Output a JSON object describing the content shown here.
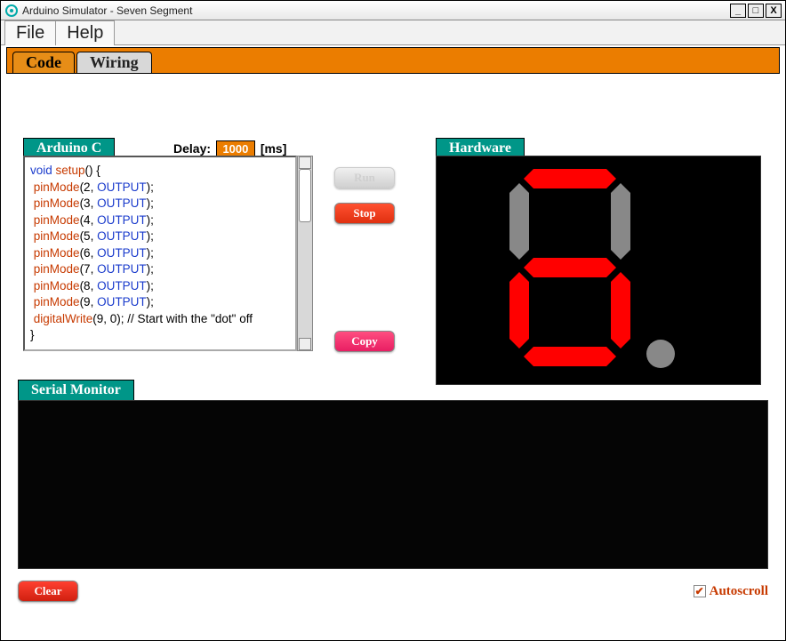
{
  "window": {
    "title": "Arduino Simulator - Seven Segment"
  },
  "menu": {
    "file": "File",
    "help": "Help"
  },
  "tabs": {
    "code": "Code",
    "wiring": "Wiring"
  },
  "labels": {
    "arduino_c": "Arduino C",
    "hardware": "Hardware",
    "serial": "Serial Monitor"
  },
  "delay": {
    "label": "Delay:",
    "value": "1000",
    "unit": "[ms]"
  },
  "buttons": {
    "run": "Run",
    "stop": "Stop",
    "copy": "Copy",
    "clear": "Clear"
  },
  "autoscroll": {
    "label": "Autoscroll",
    "checked": true
  },
  "code": {
    "l0a": "void",
    "l0b": " setup",
    "l0c": "() {",
    "pm": "pinMode",
    "a2": "(2, ",
    "a3": "(3, ",
    "a4": "(4, ",
    "a5": "(5, ",
    "a6": "(6, ",
    "a7": "(7, ",
    "a8": "(8, ",
    "a9": "(9, ",
    "out": "OUTPUT",
    "end": ");",
    "dw": "digitalWrite",
    "dwargs": "(9, 0);   // Start with the \"dot\" off",
    "close": "}"
  },
  "hardware": {
    "segments": {
      "a": true,
      "b": false,
      "c": true,
      "d": true,
      "e": true,
      "f": false,
      "g": true,
      "dp": false
    }
  }
}
